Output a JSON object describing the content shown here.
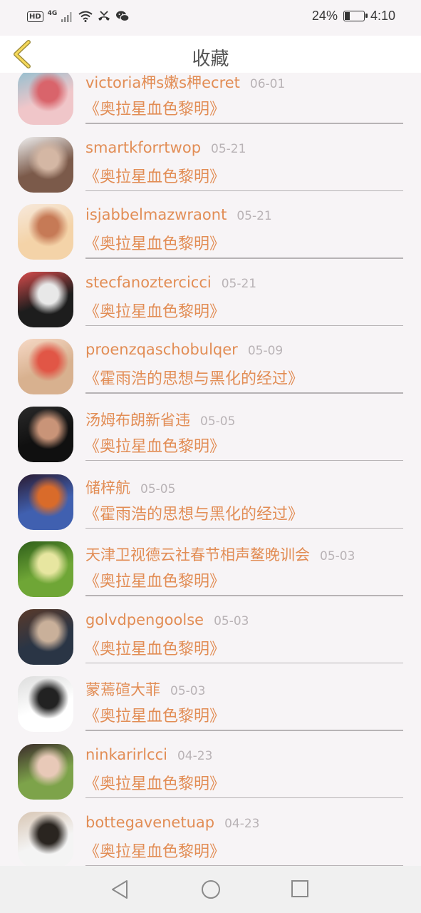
{
  "status_bar": {
    "hd": "HD",
    "network": "4G",
    "battery_percent": "24%",
    "battery_level": 0.24,
    "time": "4:10",
    "icons": [
      "signal-icon",
      "wifi-icon",
      "missed-call-icon",
      "wechat-icon",
      "battery-icon"
    ]
  },
  "header": {
    "title": "收藏",
    "back_icon": "back-chevron-icon"
  },
  "items": [
    {
      "name": "victoria柙s嫩s柙ecret",
      "date": "06-01",
      "work": "《奥拉星血色黎明》",
      "avatar_colors": [
        "#f0c6c9",
        "#d9646b",
        "#8fbfd0"
      ]
    },
    {
      "name": "smartkforrtwop",
      "date": "05-21",
      "work": "《奥拉星血色黎明》",
      "avatar_colors": [
        "#7b5a4a",
        "#d4b7a4",
        "#f0f0f0"
      ]
    },
    {
      "name": "isjabbelmazwraont",
      "date": "05-21",
      "work": "《奥拉星血色黎明》",
      "avatar_colors": [
        "#f4d3a8",
        "#c67a56",
        "#f6e9dc"
      ]
    },
    {
      "name": "stecfanoztercicci",
      "date": "05-21",
      "work": "《奥拉星血色黎明》",
      "avatar_colors": [
        "#1d1d1d",
        "#e8e8e8",
        "#d84c4c"
      ]
    },
    {
      "name": "proenzqaschobulqer",
      "date": "05-09",
      "work": "《霍雨浩的思想与黑化的经过》",
      "avatar_colors": [
        "#d8b18f",
        "#e15646",
        "#f6d9c6"
      ]
    },
    {
      "name": "汤姆布朗新省违",
      "date": "05-05",
      "work": "《奥拉星血色黎明》",
      "avatar_colors": [
        "#101010",
        "#c99478",
        "#2a2a2a"
      ]
    },
    {
      "name": "储梓航",
      "date": "05-05",
      "work": "《霍雨浩的思想与黑化的经过》",
      "avatar_colors": [
        "#4060b0",
        "#d96b2a",
        "#2a1a30"
      ]
    },
    {
      "name": "天津卫视德云社春节相声鳌晚训会",
      "date": "05-03",
      "work": "《奥拉星血色黎明》",
      "avatar_colors": [
        "#6fa636",
        "#e7e6a0",
        "#2e5e1a"
      ]
    },
    {
      "name": "golvdpengoolse",
      "date": "05-03",
      "work": "《奥拉星血色黎明》",
      "avatar_colors": [
        "#2a3545",
        "#c9b09a",
        "#5a3a2a"
      ]
    },
    {
      "name": "蒙蔫碹大菲",
      "date": "05-03",
      "work": "《奥拉星血色黎明》",
      "avatar_colors": [
        "#ffffff",
        "#222222",
        "#dddddd"
      ]
    },
    {
      "name": "ninkarirlcci",
      "date": "04-23",
      "work": "《奥拉星血色黎明》",
      "avatar_colors": [
        "#7da34a",
        "#e8c9b8",
        "#3a2a2a"
      ]
    },
    {
      "name": "bottegavenetuap",
      "date": "04-23",
      "work": "《奥拉星血色黎明》",
      "avatar_colors": [
        "#f4f4f4",
        "#2a2520",
        "#d8c6b4"
      ]
    }
  ],
  "nav_bar": {
    "back_icon": "nav-back-icon",
    "home_icon": "nav-home-icon",
    "recents_icon": "nav-recents-icon"
  }
}
